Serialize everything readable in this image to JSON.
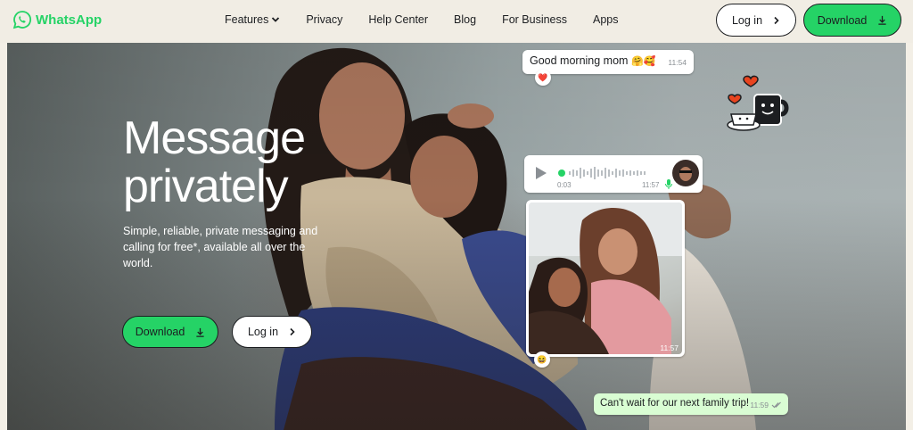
{
  "brand": {
    "name": "WhatsApp",
    "color": "#25d366",
    "icon": "whatsapp-logo-icon"
  },
  "nav": {
    "items": [
      {
        "label": "Features",
        "has_dropdown": true
      },
      {
        "label": "Privacy"
      },
      {
        "label": "Help Center"
      },
      {
        "label": "Blog"
      },
      {
        "label": "For Business"
      },
      {
        "label": "Apps"
      }
    ]
  },
  "header_actions": {
    "login_label": "Log in",
    "download_label": "Download"
  },
  "hero": {
    "title_line1": "Message",
    "title_line2": "privately",
    "subtitle": "Simple, reliable, private messaging and calling for free*, available all over the world.",
    "download_label": "Download",
    "login_label": "Log in"
  },
  "chat": {
    "message1": {
      "text": "Good morning mom",
      "emoji": "🤗🥰",
      "time": "11:54",
      "reaction": "❤️"
    },
    "voice": {
      "elapsed": "0:03",
      "time": "11:57"
    },
    "photo": {
      "time": "11:57",
      "reaction": "😆"
    },
    "message3": {
      "text": "Can't wait for our next family trip!",
      "time": "11:59"
    }
  },
  "colors": {
    "accent": "#25d366",
    "bubble_out": "#d9fdd3",
    "ink": "#1c1e21"
  }
}
